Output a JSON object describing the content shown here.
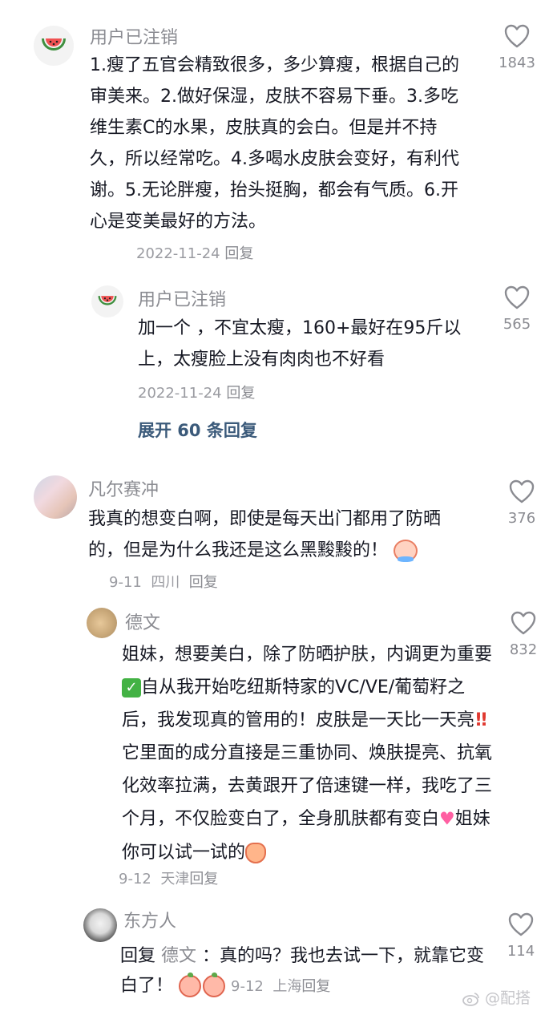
{
  "comments": [
    {
      "username": "用户已注销",
      "text": "1.瘦了五官会精致很多，多少算瘦，根据自己的审美来。2.做好保湿，皮肤不容易下垂。3.多吃维生素C的水果，皮肤真的会白。但是并不持久，所以经常吃。4.多喝水皮肤会变好，有利代谢。5.无论胖瘦，抬头挺胸，都会有气质。6.开心是变美最好的方法。",
      "date": "2022-11-24",
      "reply_label": "回复",
      "likes": "1843",
      "replies": [
        {
          "username": "用户已注销",
          "text": "加一个 ，不宜太瘦，160+最好在95斤以上，太瘦脸上没有肉肉也不好看",
          "date": "2022-11-24",
          "reply_label": "回复",
          "likes": "565"
        }
      ],
      "expand_label": "展开 60 条回复"
    },
    {
      "username": "凡尔赛冲",
      "text": "我真的想变白啊，即使是每天出门都用了防晒的，但是为什么我还是这么黑黢黢的！",
      "date": "9-11",
      "location": "四川",
      "reply_label": "回复",
      "likes": "376",
      "replies": [
        {
          "username": "德文",
          "text_1": "姐妹，想要美白，除了防晒护肤，内调更为重要",
          "text_2": "自从我开始吃纽斯特家的VC/VE/葡萄籽之后，我发现真的管用的！皮肤是一天比一天亮",
          "text_3": "它里面的成分直接是三重协同、焕肤提亮、抗氧化效率拉满，去黄跟开了倍速键一样，我吃了三个月，不仅脸变白了，全身肌肤都有变白",
          "text_4": "姐妹你可以试一试的",
          "date": "9-12",
          "location": "天津",
          "reply_label": "回复",
          "likes": "832"
        },
        {
          "username": "东方人",
          "reply_prefix": "回复",
          "reply_to": "德文",
          "reply_sep": "：",
          "text": "真的吗？我也去试一下，就靠它变白了！",
          "date": "9-12",
          "location": "上海",
          "reply_label": "回复",
          "likes": "114"
        }
      ]
    }
  ],
  "watermark": "@配搭",
  "icons": {
    "like": "heart-outline-icon",
    "watermelon": "watermelon-icon",
    "weibo": "weibo-logo-icon"
  },
  "colors": {
    "username": "#8a8b91",
    "text": "#161823",
    "expand": "#3b5a7a",
    "meta": "#9a9ba1"
  }
}
